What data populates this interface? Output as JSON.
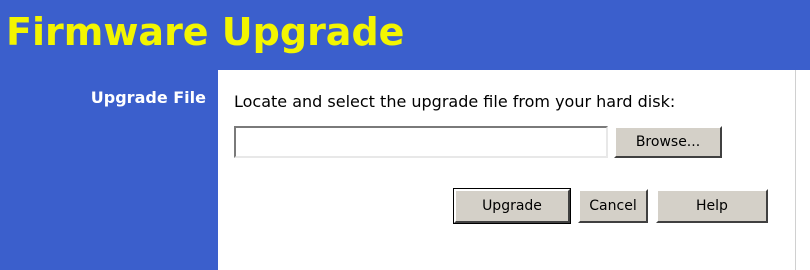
{
  "header": {
    "title": "Firmware Upgrade"
  },
  "sidebar": {
    "section_label": "Upgrade File"
  },
  "main": {
    "instruction": "Locate and select the upgrade file from your hard disk:",
    "file_input": {
      "value": "",
      "placeholder": ""
    },
    "buttons": {
      "browse": "Browse...",
      "upgrade": "Upgrade",
      "cancel": "Cancel",
      "help": "Help"
    }
  },
  "colors": {
    "header_bg": "#3b5fcc",
    "title_text": "#f3f500",
    "sidebar_text": "#ffffff",
    "button_face": "#d4d0c8"
  }
}
